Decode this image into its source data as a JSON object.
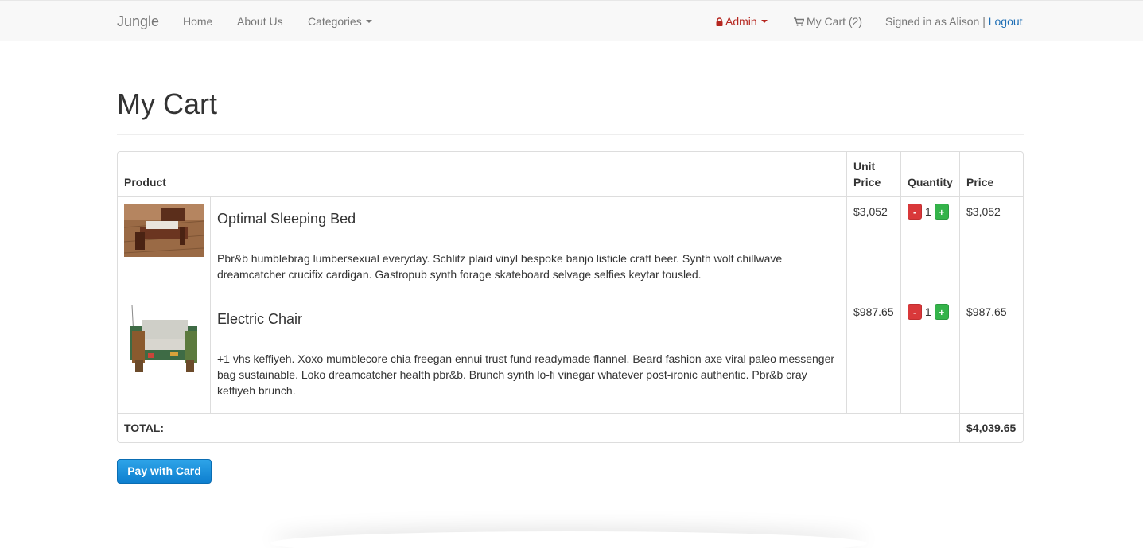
{
  "nav": {
    "brand": "Jungle",
    "home": "Home",
    "about": "About Us",
    "categories": "Categories",
    "admin": "Admin",
    "cart": "My Cart (2)",
    "signed_in": "Signed in as Alison |",
    "logout": "Logout"
  },
  "page": {
    "title": "My Cart"
  },
  "table": {
    "headers": {
      "product": "Product",
      "unit_price": "Unit Price",
      "quantity": "Quantity",
      "price": "Price"
    },
    "items": [
      {
        "name": "Optimal Sleeping Bed",
        "description": "Pbr&b humblebrag lumbersexual everyday. Schlitz plaid vinyl bespoke banjo listicle craft beer. Synth wolf chillwave dreamcatcher crucifix cardigan. Gastropub synth forage skateboard selvage selfies keytar tousled.",
        "unit_price": "$3,052",
        "quantity": "1",
        "price": "$3,052",
        "minus": "-",
        "plus": "+"
      },
      {
        "name": "Electric Chair",
        "description": "+1 vhs keffiyeh. Xoxo mumblecore chia freegan ennui trust fund readymade flannel. Beard fashion axe viral paleo messenger bag sustainable. Loko dreamcatcher health pbr&b. Brunch synth lo-fi vinegar whatever post-ironic authentic. Pbr&b cray keffiyeh brunch.",
        "unit_price": "$987.65",
        "quantity": "1",
        "price": "$987.65",
        "minus": "-",
        "plus": "+"
      }
    ],
    "total_label": "TOTAL:",
    "total_value": "$4,039.65"
  },
  "actions": {
    "pay": "Pay with Card"
  },
  "colors": {
    "admin": "#b5261f",
    "link": "#1f6fb5",
    "minus_button": "#d9383a",
    "plus_button": "#34b34a",
    "pay_button": "#1a8fdb"
  },
  "icons": {
    "admin": "lock-icon",
    "cart": "shopping-cart-icon"
  }
}
